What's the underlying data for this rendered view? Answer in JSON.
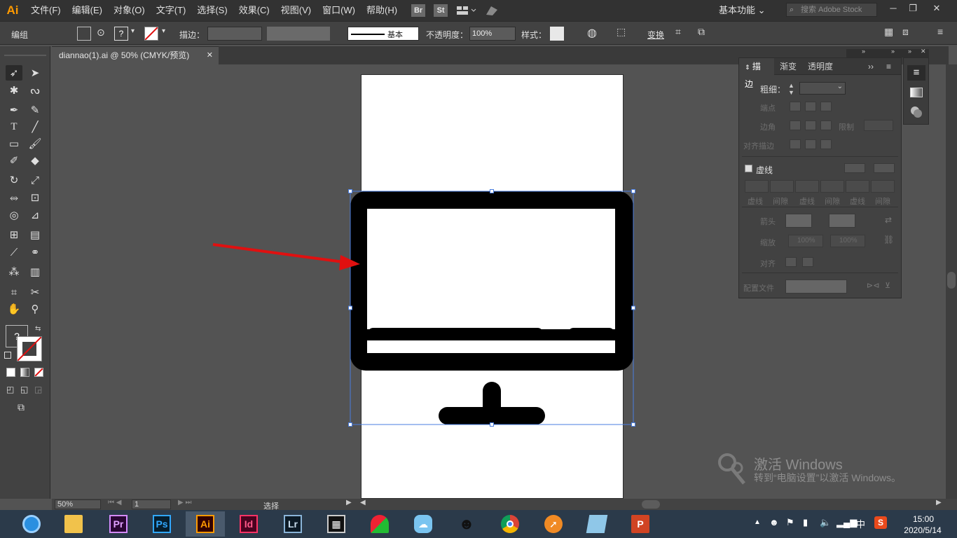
{
  "app": {
    "logo": "Ai",
    "workspace": "基本功能",
    "search_placeholder": "搜索 Adobe Stock"
  },
  "menu": [
    "文件(F)",
    "编辑(E)",
    "对象(O)",
    "文字(T)",
    "选择(S)",
    "效果(C)",
    "视图(V)",
    "窗口(W)",
    "帮助(H)"
  ],
  "menu_badges": {
    "bridge": "Br",
    "stock": "St"
  },
  "control_bar": {
    "selection_label": "编组",
    "stroke_label": "描边：",
    "stroke_profile": "基本",
    "opacity_label": "不透明度：",
    "opacity_value": "100%",
    "style_label": "样式：",
    "transform_label": "变换",
    "fill_unknown": "?"
  },
  "document": {
    "tab_title": "diannao(1).ai @ 50% (CMYK/预览)",
    "close": "✕"
  },
  "status_bar": {
    "zoom": "50%",
    "artboard_number": "1",
    "tool_name": "选择"
  },
  "toolbar": {
    "fill_unknown": "?"
  },
  "stroke_panel": {
    "tabs": [
      "描边",
      "渐变",
      "透明度"
    ],
    "weight_label": "粗细：",
    "cap_label": "端点",
    "corner_label": "边角",
    "limit_label": "限制",
    "align_label": "对齐描边",
    "dashed_label": "虚线",
    "dash_labels": [
      "虚线",
      "间隙",
      "虚线",
      "间隙",
      "虚线",
      "间隙"
    ],
    "arrow_label": "箭头",
    "scale_label": "缩放",
    "scale_values": [
      "100%",
      "100%"
    ],
    "align_arrows_label": "对齐",
    "profile_label": "配置文件"
  },
  "watermark": {
    "line1": "激活 Windows",
    "line2": "转到“电脑设置”以激活 Windows。"
  },
  "taskbar": {
    "apps": [
      {
        "name": "browser-360",
        "label": ""
      },
      {
        "name": "file-explorer",
        "label": ""
      },
      {
        "name": "premiere",
        "label": "Pr"
      },
      {
        "name": "photoshop",
        "label": "Ps"
      },
      {
        "name": "illustrator",
        "label": "Ai"
      },
      {
        "name": "indesign",
        "label": "Id"
      },
      {
        "name": "lightroom",
        "label": "Lr"
      },
      {
        "name": "video-editor",
        "label": ""
      },
      {
        "name": "app-green-red",
        "label": ""
      },
      {
        "name": "app-blue-cloud",
        "label": ""
      },
      {
        "name": "qq",
        "label": ""
      },
      {
        "name": "chrome",
        "label": ""
      },
      {
        "name": "app-orange",
        "label": ""
      },
      {
        "name": "app-notebook",
        "label": ""
      },
      {
        "name": "powerpoint",
        "label": "P"
      }
    ],
    "time": "15:00",
    "date": "2020/5/14",
    "ime": "中"
  },
  "colors": {
    "illustrator_orange": "#ff9a00",
    "selection_blue": "#4a7ee0",
    "arrow_red": "#e01010",
    "artwork_black": "#000000"
  }
}
